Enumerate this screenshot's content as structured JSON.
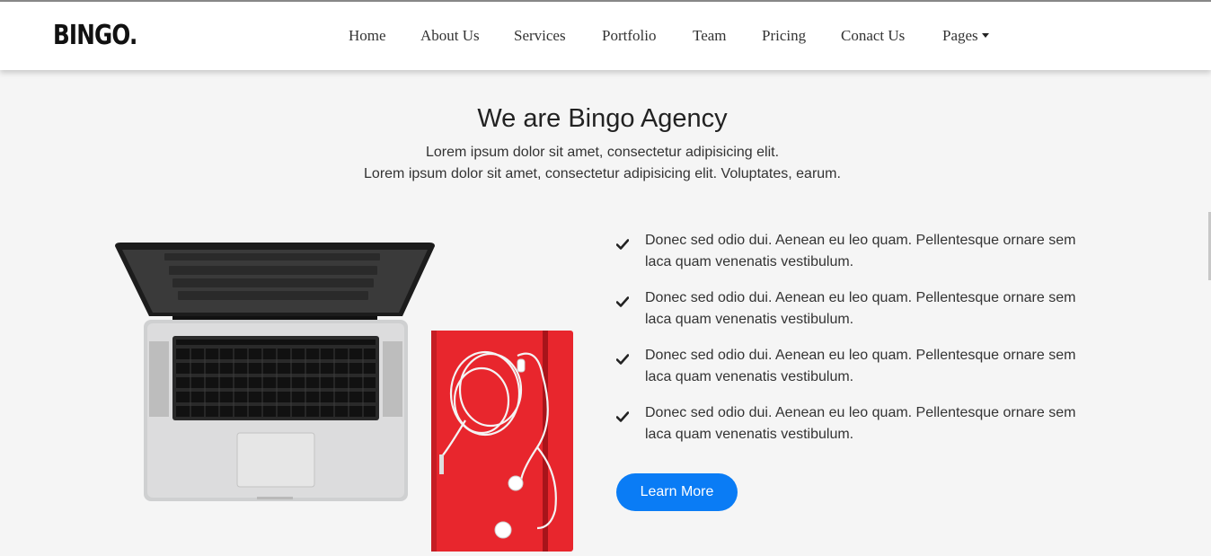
{
  "header": {
    "brand": "BINGO.",
    "nav": [
      {
        "label": "Home"
      },
      {
        "label": "About Us"
      },
      {
        "label": "Services"
      },
      {
        "label": "Portfolio"
      },
      {
        "label": "Team"
      },
      {
        "label": "Pricing"
      },
      {
        "label": "Conact Us"
      },
      {
        "label": "Pages",
        "icon": "caret-down-icon"
      }
    ]
  },
  "hero": {
    "title": "We are Bingo Agency",
    "subtitle_line1": "Lorem ipsum dolor sit amet, consectetur adipisicing elit.",
    "subtitle_line2": "Lorem ipsum dolor sit amet, consectetur adipisicing elit. Voluptates, earum."
  },
  "features": {
    "icon": "check-icon",
    "items": [
      {
        "line1": "Donec sed odio dui. Aenean eu leo quam. Pellentesque ornare sem",
        "line2": "laca quam venenatis vestibulum."
      },
      {
        "line1": "Donec sed odio dui. Aenean eu leo quam. Pellentesque ornare sem",
        "line2": "laca quam venenatis vestibulum."
      },
      {
        "line1": "Donec sed odio dui. Aenean eu leo quam. Pellentesque ornare sem",
        "line2": "laca quam venenatis vestibulum."
      },
      {
        "line1": "Donec sed odio dui. Aenean eu leo quam. Pellentesque ornare sem",
        "line2": "laca quam venenatis vestibulum."
      }
    ]
  },
  "cta": {
    "label": "Learn More"
  },
  "colors": {
    "accent": "#0a7cf5",
    "notebook": "#e8262d",
    "background": "#f5f5f5"
  }
}
